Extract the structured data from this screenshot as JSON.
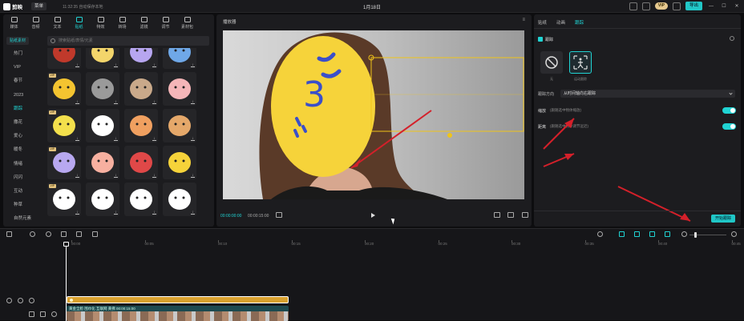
{
  "topbar": {
    "app_name": "剪映",
    "menu_label": "菜单",
    "autosave": "11:32:35 自动保存本地",
    "doc_title": "1月18日",
    "vip_label": "VIP",
    "export_label": "导出",
    "accent_color": "#20d3d3"
  },
  "tool_tabs": [
    {
      "label": "媒体",
      "icon": "media-icon"
    },
    {
      "label": "音频",
      "icon": "audio-icon"
    },
    {
      "label": "文本",
      "icon": "text-icon"
    },
    {
      "label": "贴纸",
      "icon": "sticker-icon"
    },
    {
      "label": "特效",
      "icon": "effects-icon"
    },
    {
      "label": "转场",
      "icon": "transition-icon"
    },
    {
      "label": "滤镜",
      "icon": "filter-icon"
    },
    {
      "label": "调节",
      "icon": "adjust-icon"
    },
    {
      "label": "素材包",
      "icon": "package-icon"
    }
  ],
  "sticker_panel": {
    "header": "贴纸素材",
    "search_placeholder": "搜索贴纸/表情/元素",
    "categories": [
      "热门",
      "VIP",
      "春节",
      "2023",
      "跟踪",
      "撒花",
      "爱心",
      "暖冬",
      "情绪",
      "闪闪",
      "互动",
      "种草",
      "自然元素"
    ],
    "vip_badge": "VIP"
  },
  "player": {
    "title": "播放器",
    "current_time": "00:00:00:00",
    "total_time": "00:00:15:00"
  },
  "right_panel": {
    "tabs": [
      "贴纸",
      "动画",
      "跟踪"
    ],
    "tracking_label": "跟踪",
    "mode_none": "无",
    "mode_track": "运动跟踪",
    "direction_label": "跟踪方向",
    "direction_value": "从时间轴向右跟踪",
    "scale_label": "缩放",
    "scale_desc": "(跟随选中物体缩放)",
    "distance_label": "距离",
    "distance_desc": "(跟随选中物体调节远近)",
    "start_button": "开始跟踪"
  },
  "timeline": {
    "ticks": [
      "00:00",
      "00:05",
      "00:10",
      "00:15",
      "00:20",
      "00:25",
      "00:30",
      "00:35",
      "00:40",
      "00:45"
    ],
    "video_clip_label": "黄金全脸 围巾化 互联网 黄佛  00:00:15:00"
  }
}
